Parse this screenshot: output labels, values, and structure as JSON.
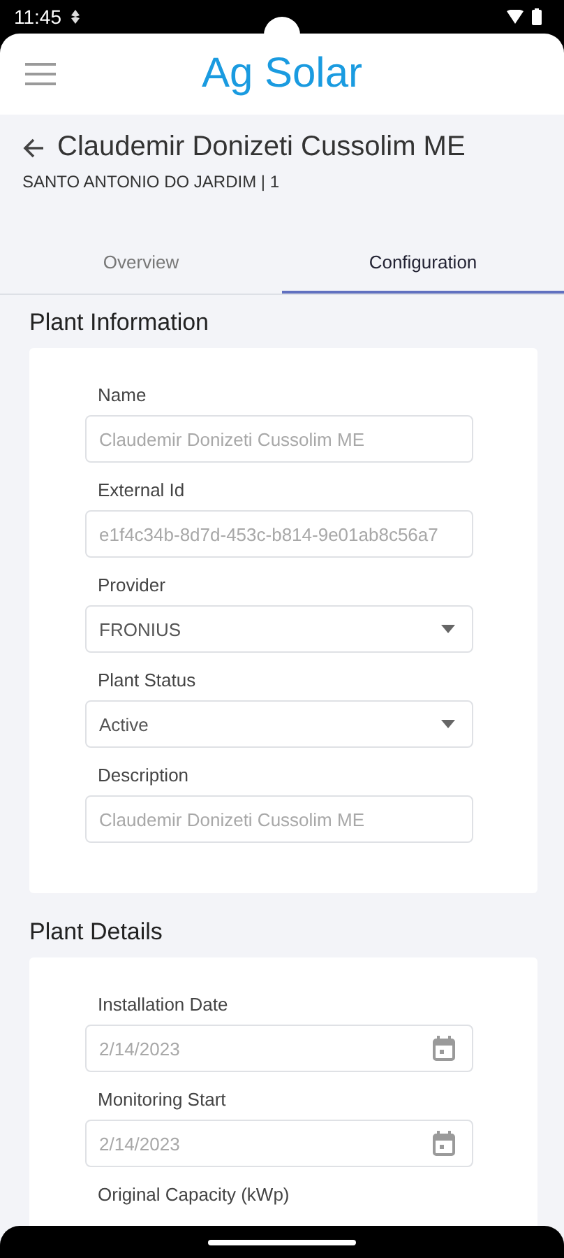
{
  "status_bar": {
    "time": "11:45"
  },
  "app_bar": {
    "title": "Ag Solar"
  },
  "page": {
    "title": "Claudemir Donizeti Cussolim ME",
    "subtitle": "SANTO ANTONIO DO JARDIM | 1"
  },
  "tabs": [
    {
      "label": "Overview",
      "selected": false
    },
    {
      "label": "Configuration",
      "selected": true
    }
  ],
  "sections": [
    {
      "title": "Plant Information",
      "fields": [
        {
          "kind": "text",
          "label": "Name",
          "value": "Claudemir Donizeti Cussolim ME",
          "disabled": true
        },
        {
          "kind": "text",
          "label": "External Id",
          "value": "e1f4c34b-8d7d-453c-b814-9e01ab8c56a7",
          "disabled": true
        },
        {
          "kind": "select",
          "label": "Provider",
          "value": "FRONIUS",
          "disabled": false
        },
        {
          "kind": "select",
          "label": "Plant Status",
          "value": "Active",
          "disabled": false
        },
        {
          "kind": "text",
          "label": "Description",
          "value": "Claudemir Donizeti Cussolim ME",
          "disabled": true
        }
      ]
    },
    {
      "title": "Plant Details",
      "fields": [
        {
          "kind": "date",
          "label": "Installation Date",
          "value": "2/14/2023",
          "disabled": true
        },
        {
          "kind": "date",
          "label": "Monitoring Start",
          "value": "2/14/2023",
          "disabled": true
        },
        {
          "kind": "text",
          "label": "Original Capacity (kWp)"
        }
      ]
    }
  ]
}
